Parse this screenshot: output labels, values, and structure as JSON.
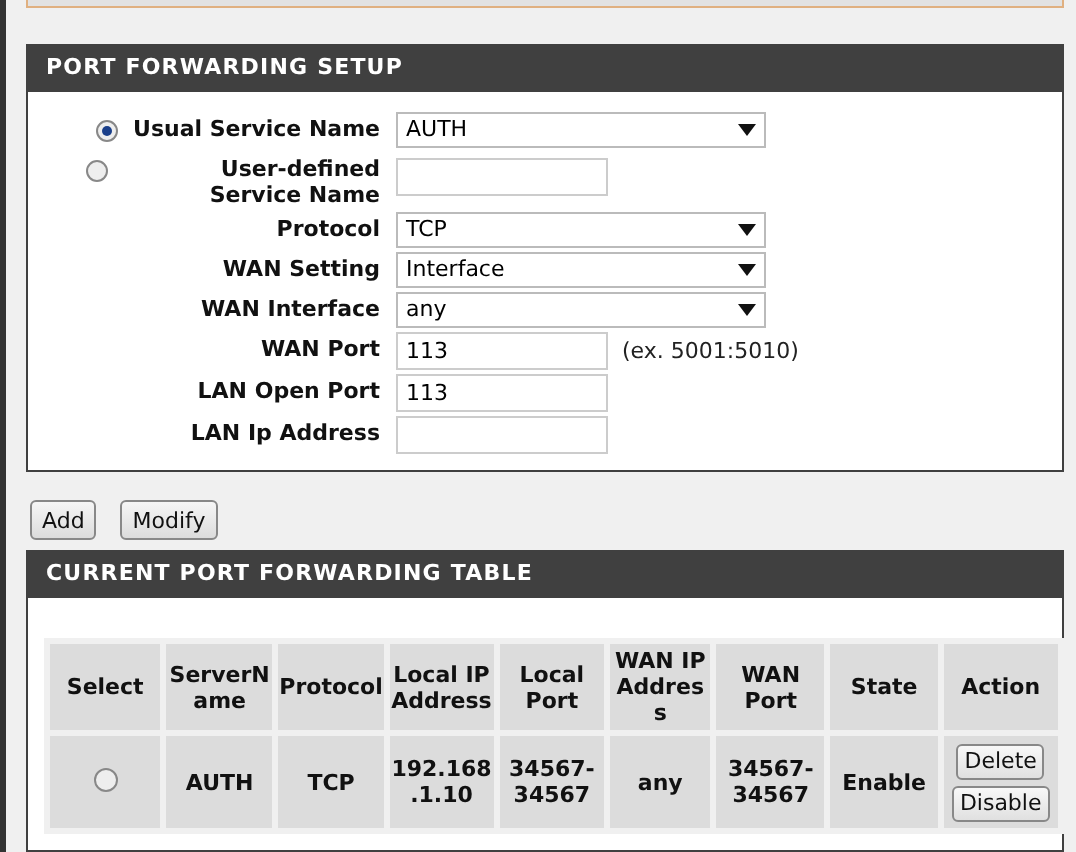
{
  "setup": {
    "title": "PORT FORWARDING SETUP",
    "fields": [
      {
        "kind": "radio-select",
        "label": "Usual Service Name",
        "selected": true,
        "value": "AUTH"
      },
      {
        "kind": "radio-text",
        "label": "User-defined Service Name",
        "selected": false
      },
      {
        "kind": "select",
        "label": "Protocol",
        "value": "TCP"
      },
      {
        "kind": "select",
        "label": "WAN Setting",
        "value": "Interface"
      },
      {
        "kind": "select",
        "label": "WAN Interface",
        "value": "any"
      },
      {
        "kind": "text",
        "label": "WAN Port",
        "value": "113",
        "hint": "(ex. 5001:5010)"
      },
      {
        "kind": "text",
        "label": "LAN Open Port",
        "value": "113"
      },
      {
        "kind": "text",
        "label": "LAN Ip Address"
      }
    ]
  },
  "buttons": [
    "Add",
    "Modify"
  ],
  "table": {
    "title": "CURRENT PORT FORWARDING TABLE",
    "columns": [
      "Select",
      "ServerName",
      "Protocol",
      "Local IP Address",
      "Local Port",
      "WAN IP Address",
      "WAN Port",
      "State",
      "Action"
    ],
    "rows": [
      {
        "selected": false,
        "cells": [
          "",
          "AUTH",
          "TCP",
          "192.168.1.10",
          "34567-34567",
          "any",
          "34567-34567",
          "Enable"
        ],
        "actions": [
          "Delete",
          "Disable"
        ]
      }
    ]
  }
}
